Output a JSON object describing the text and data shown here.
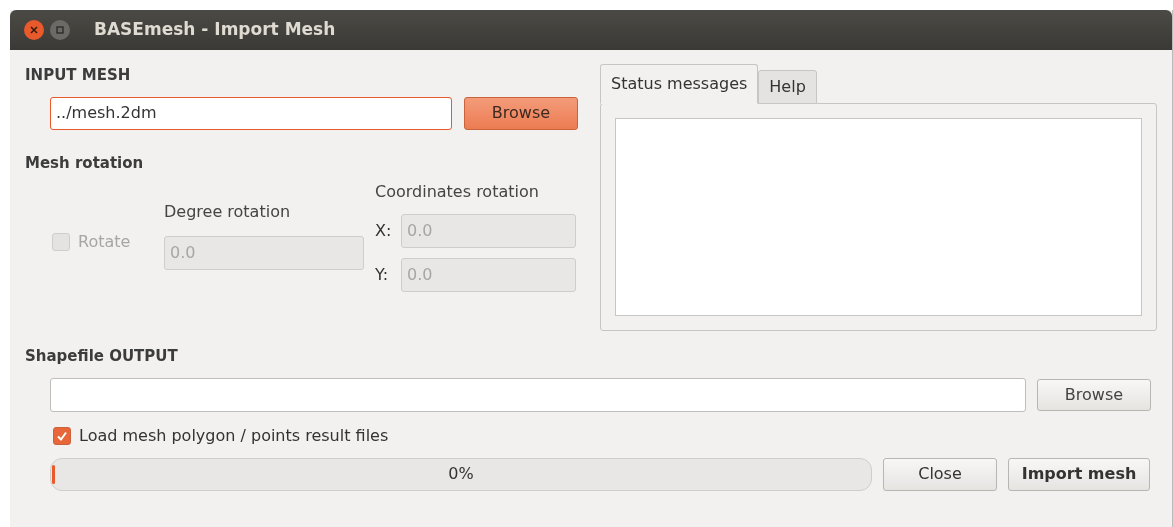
{
  "window": {
    "title": "BASEmesh - Import Mesh"
  },
  "input_mesh": {
    "heading": "INPUT MESH",
    "path": {
      "value": "../mesh.2dm",
      "focused": true
    },
    "browse_button": {
      "label": "Browse",
      "highlighted": true
    }
  },
  "mesh_rotation": {
    "heading": "Mesh rotation",
    "rotate": {
      "label": "Rotate",
      "checked": false,
      "disabled": true
    },
    "degree_label": "Degree rotation",
    "degree": {
      "value": "0.0",
      "disabled": true
    },
    "coordinates_label": "Coordinates rotation",
    "coordinates": [
      {
        "label": "X:",
        "value": "0.0",
        "disabled": true
      },
      {
        "label": "Y:",
        "value": "0.0",
        "disabled": true
      }
    ]
  },
  "tabs": [
    {
      "label": "Status messages",
      "selected": true
    },
    {
      "label": "Help",
      "selected": false
    }
  ],
  "shapefile_output": {
    "heading": "Shapefile OUTPUT",
    "browse_button": {
      "label": "Browse",
      "highlighted": false
    }
  },
  "load_results": {
    "label": "Load mesh polygon / points result files",
    "checked": true
  },
  "progress": {
    "level": 0,
    "reading": "0%"
  },
  "buttons": [
    {
      "label": "Close",
      "kind": "normal"
    },
    {
      "label": "Import mesh",
      "kind": "default"
    }
  ]
}
